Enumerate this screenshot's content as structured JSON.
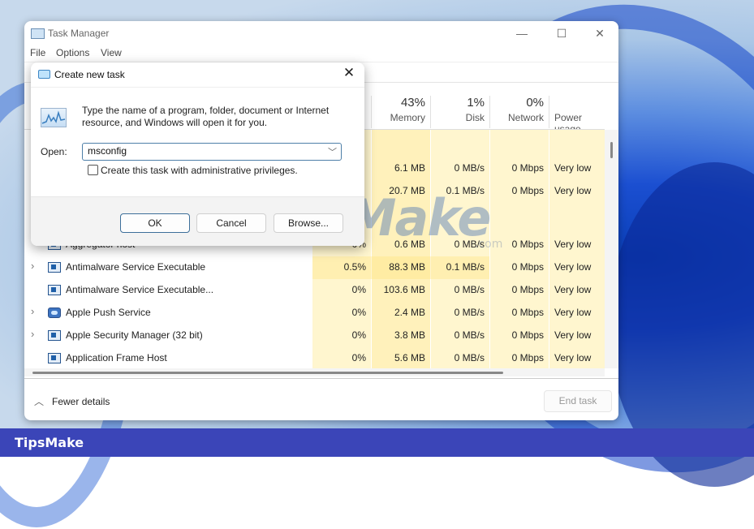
{
  "footer": {
    "brand": "TipsMake"
  },
  "watermark": {
    "text": "TipsMake",
    "suffix": ".com"
  },
  "task_manager": {
    "title": "Task Manager",
    "window_controls": {
      "minimize": "—",
      "maximize": "☐",
      "close": "✕"
    },
    "menu": [
      "File",
      "Options",
      "View"
    ],
    "columns": [
      {
        "pct": "43%",
        "name": "Memory"
      },
      {
        "pct": "1%",
        "name": "Disk"
      },
      {
        "pct": "0%",
        "name": "Network"
      },
      {
        "pct": "",
        "name": "Power usage"
      }
    ],
    "rows": [
      {
        "name": "",
        "expander": false,
        "icon": "app",
        "cpu": "",
        "memory": "6.1 MB",
        "disk": "0 MB/s",
        "network": "0 Mbps",
        "power": "Very low"
      },
      {
        "name": "",
        "expander": false,
        "icon": "app",
        "cpu": "",
        "memory": "20.7 MB",
        "disk": "0.1 MB/s",
        "network": "0 Mbps",
        "power": "Very low"
      },
      {
        "name": "",
        "expander": false,
        "icon": "app",
        "cpu": "",
        "memory": "",
        "disk": "",
        "network": "",
        "power": ""
      },
      {
        "name": "Aggregator host",
        "expander": false,
        "icon": "app",
        "cpu": "0%",
        "memory": "0.6 MB",
        "disk": "0 MB/s",
        "network": "0 Mbps",
        "power": "Very low"
      },
      {
        "name": "Antimalware Service Executable",
        "expander": true,
        "icon": "app",
        "cpu": "0.5%",
        "memory": "88.3 MB",
        "disk": "0.1 MB/s",
        "network": "0 Mbps",
        "power": "Very low"
      },
      {
        "name": "Antimalware Service Executable...",
        "expander": false,
        "icon": "app",
        "cpu": "0%",
        "memory": "103.6 MB",
        "disk": "0 MB/s",
        "network": "0 Mbps",
        "power": "Very low"
      },
      {
        "name": "Apple Push Service",
        "expander": true,
        "icon": "cloud",
        "cpu": "0%",
        "memory": "2.4 MB",
        "disk": "0 MB/s",
        "network": "0 Mbps",
        "power": "Very low"
      },
      {
        "name": "Apple Security Manager (32 bit)",
        "expander": true,
        "icon": "app",
        "cpu": "0%",
        "memory": "3.8 MB",
        "disk": "0 MB/s",
        "network": "0 Mbps",
        "power": "Very low"
      },
      {
        "name": "Application Frame Host",
        "expander": false,
        "icon": "app",
        "cpu": "0%",
        "memory": "5.6 MB",
        "disk": "0 MB/s",
        "network": "0 Mbps",
        "power": "Very low"
      }
    ],
    "fewer_details": "Fewer details",
    "end_task": "End task"
  },
  "dialog": {
    "title": "Create new task",
    "close": "✕",
    "message": "Type the name of a program, folder, document or Internet resource, and Windows will open it for you.",
    "open_label": "Open:",
    "open_value": "msconfig",
    "admin_label": "Create this task with administrative privileges.",
    "admin_checked": false,
    "buttons": {
      "ok": "OK",
      "cancel": "Cancel",
      "browse": "Browse..."
    }
  }
}
